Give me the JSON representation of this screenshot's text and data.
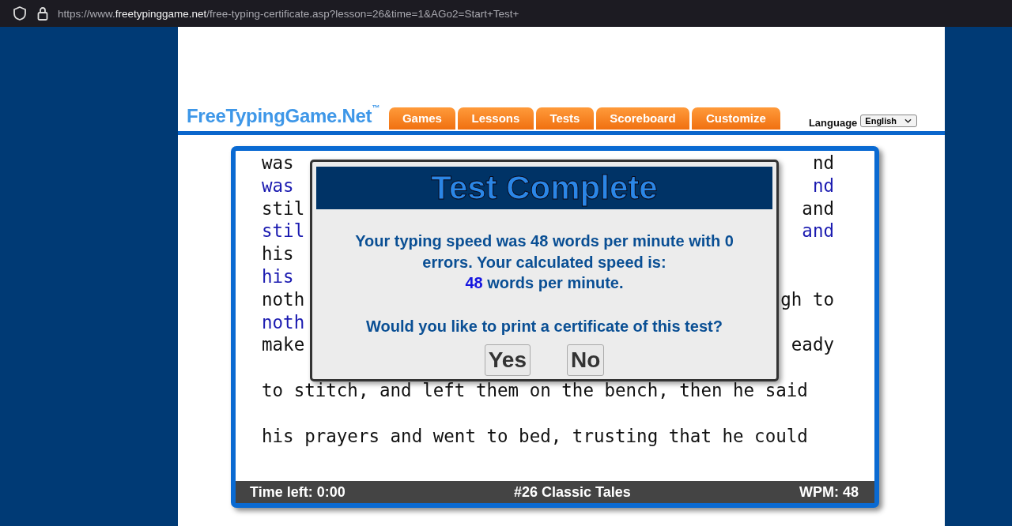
{
  "address_bar": {
    "url_scheme": "https://www.",
    "url_host": "freetypinggame.net",
    "url_path": "/free-typing-certificate.asp?lesson=26&time=1&AGo2=Start+Test+"
  },
  "header": {
    "logo": "FreeTypingGame.Net",
    "logo_mark": "™",
    "tabs": [
      {
        "label": "Games"
      },
      {
        "label": "Lessons"
      },
      {
        "label": "Tests"
      },
      {
        "label": "Scoreboard"
      },
      {
        "label": "Customize"
      }
    ],
    "language_label": "Language",
    "language_value": "English"
  },
  "typing_area": {
    "lines": [
      {
        "source": {
          "left": "was",
          "right": "nd"
        },
        "typed": {
          "left": "was",
          "right": "nd"
        }
      },
      {
        "source": {
          "left": "stil",
          "right": "and"
        },
        "typed": {
          "left": "stil",
          "right": "and"
        }
      },
      {
        "source": {
          "left": "his"
        },
        "typed": {
          "left": "his"
        }
      },
      {
        "source": {
          "left": "noth",
          "right": "gh to"
        },
        "typed": {
          "left": "noth"
        }
      },
      {
        "source": {
          "left": "make",
          "right": "eady"
        }
      },
      {
        "source": {
          "left": "to stitch, and left them on the bench, then he said"
        }
      },
      {
        "source": {
          "left": "his prayers and went to bed, trusting that he could"
        }
      }
    ],
    "status_bar": {
      "time_left": "Time left: 0:00",
      "lesson": "#26 Classic Tales",
      "wpm": "WPM: 48"
    }
  },
  "dialog": {
    "title": "Test Complete",
    "message": "Your typing speed was 48 words per minute with 0 errors. Your calculated speed is:",
    "speed_value": "48",
    "speed_unit": "words per minute.",
    "question": "Would you like to print a certificate of this test?",
    "buttons": [
      "Yes",
      "No"
    ]
  }
}
